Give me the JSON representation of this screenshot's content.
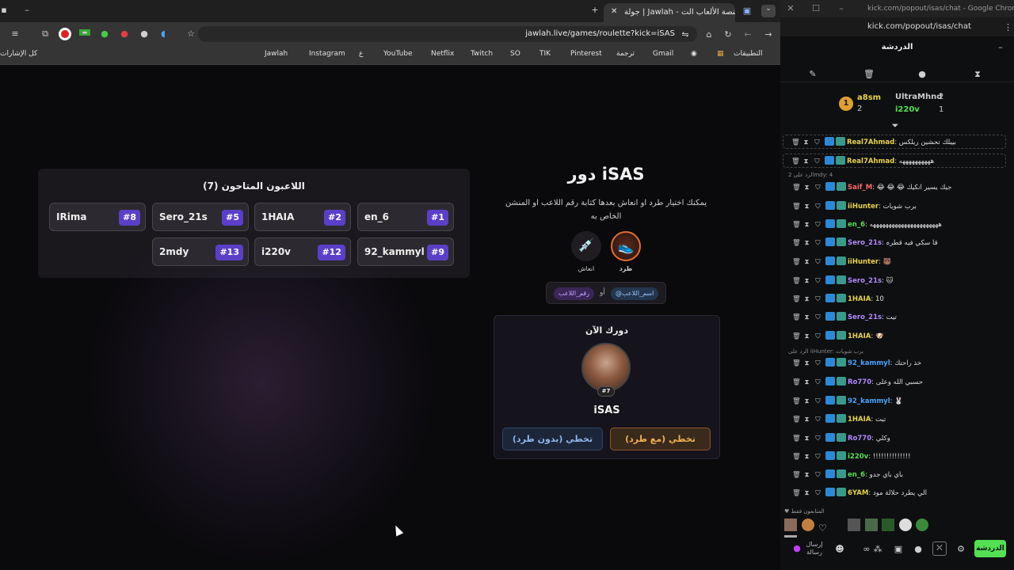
{
  "browser": {
    "tab_title": "جولة | Jawlah - منصة الألعاب الت...",
    "url": "jawlah.live/games/roulette?kick=iSAS",
    "bookmarks": [
      "التطبيقات",
      "Gmail",
      "ترجمة",
      "Pinterest",
      "TIK",
      "SO",
      "Twitch",
      "Netflix",
      "YouTube",
      "ع",
      "Instagram",
      "Jawlah"
    ],
    "bookmarks_folder": "كل الإشارات"
  },
  "game": {
    "panel_title": "اللاعبون المتاحون (7)",
    "players": [
      {
        "name": "en_6",
        "num": "#1"
      },
      {
        "name": "1HAIA",
        "num": "#2"
      },
      {
        "name": "Sero_21s",
        "num": "#5"
      },
      {
        "name": "IRima",
        "num": "#8"
      },
      {
        "name": "92_kammyl",
        "num": "#9"
      },
      {
        "name": "i220v",
        "num": "#12"
      },
      {
        "name": "2mdy",
        "num": "#13"
      }
    ],
    "turn_title": "دور iSAS",
    "description": "يمكنك اختيار طرد او انعاش بعدها كتابة رقم اللاعب او المنشن الخاص به",
    "option_kick": "طرد",
    "option_revive": "انعاش",
    "hint_mention": "@اسم_اللاعب",
    "hint_or": "أو",
    "hint_number": "رقم_اللاعب",
    "your_turn": "دورك الآن",
    "current_player": "iSAS",
    "current_num": "#7",
    "btn_skip_kick": "تخطي (مع طرد)",
    "btn_skip_no_kick": "تخطي (بدون طرد)",
    "colors": {
      "accent": "#5b3fc9",
      "orange": "#e0a040",
      "blue": "#7aa3e0"
    }
  },
  "chat": {
    "window_title": "kick.com/popout/isas/chat - Google Chrome",
    "url": "kick.com/popout/isas/chat",
    "header": "الدردشة",
    "leaderboard": [
      {
        "name": "a8sm",
        "count": "2"
      },
      {
        "name": "UltraMhnd",
        "count": "2"
      },
      {
        "name": "i220v",
        "count": "1"
      }
    ],
    "rank": "1",
    "messages": [
      {
        "user": "Real7Ahmad",
        "color": "#e8d34a",
        "text": "بييلك تحشين ريلكس",
        "pinned": true
      },
      {
        "user": "Real7Ahmad",
        "color": "#e8d34a",
        "text": "ههههههههههه",
        "pinned": true
      },
      {
        "reply": "الرد على 2mdy: 4"
      },
      {
        "user": "Saif_M",
        "color": "#ff6a6a",
        "text": "😂 😂 😂 جيك يسير انكيك"
      },
      {
        "user": "iiHunter",
        "color": "#e8d34a",
        "text": "برب شويات"
      },
      {
        "user": "en_6",
        "color": "#53e053",
        "text": "ههههههههههههههههههههههه"
      },
      {
        "user": "Sero_21s",
        "color": "#b388ff",
        "text": "قا سكي فيه قطره"
      },
      {
        "user": "iiHunter",
        "color": "#e8d34a",
        "text": "🐻"
      },
      {
        "user": "Sero_21s",
        "color": "#b388ff",
        "text": "🐱"
      },
      {
        "user": "1HAIA",
        "color": "#e8d34a",
        "text": "10"
      },
      {
        "user": "Sero_21s",
        "color": "#b388ff",
        "text": "تيت"
      },
      {
        "user": "1HAIA",
        "color": "#e8d34a",
        "text": "🐶"
      },
      {
        "reply": "الرد على iiHunter: برب شويات"
      },
      {
        "user": "92_kammyl",
        "color": "#4aa3ff",
        "text": "خذ راحتك"
      },
      {
        "user": "Ro770",
        "color": "#b388ff",
        "text": "حسبي الله وعلى"
      },
      {
        "user": "92_kammyl",
        "color": "#4aa3ff",
        "text": "🐰"
      },
      {
        "user": "1HAIA",
        "color": "#e8d34a",
        "text": "تيت"
      },
      {
        "user": "Ro770",
        "color": "#b388ff",
        "text": "وكلي"
      },
      {
        "user": "i220v",
        "color": "#53e053",
        "text": "!!!!!!!!!!!!!!"
      },
      {
        "user": "en_6",
        "color": "#53e053",
        "text": "باي باي جدو"
      },
      {
        "user": "6YAM",
        "color": "#e8d34a",
        "text": "الي يطرد حلالة مود"
      }
    ],
    "subscribers_only": "المتابعون فقط",
    "input_placeholder": "إرسال رسالة",
    "send_label": "الدردشة"
  }
}
